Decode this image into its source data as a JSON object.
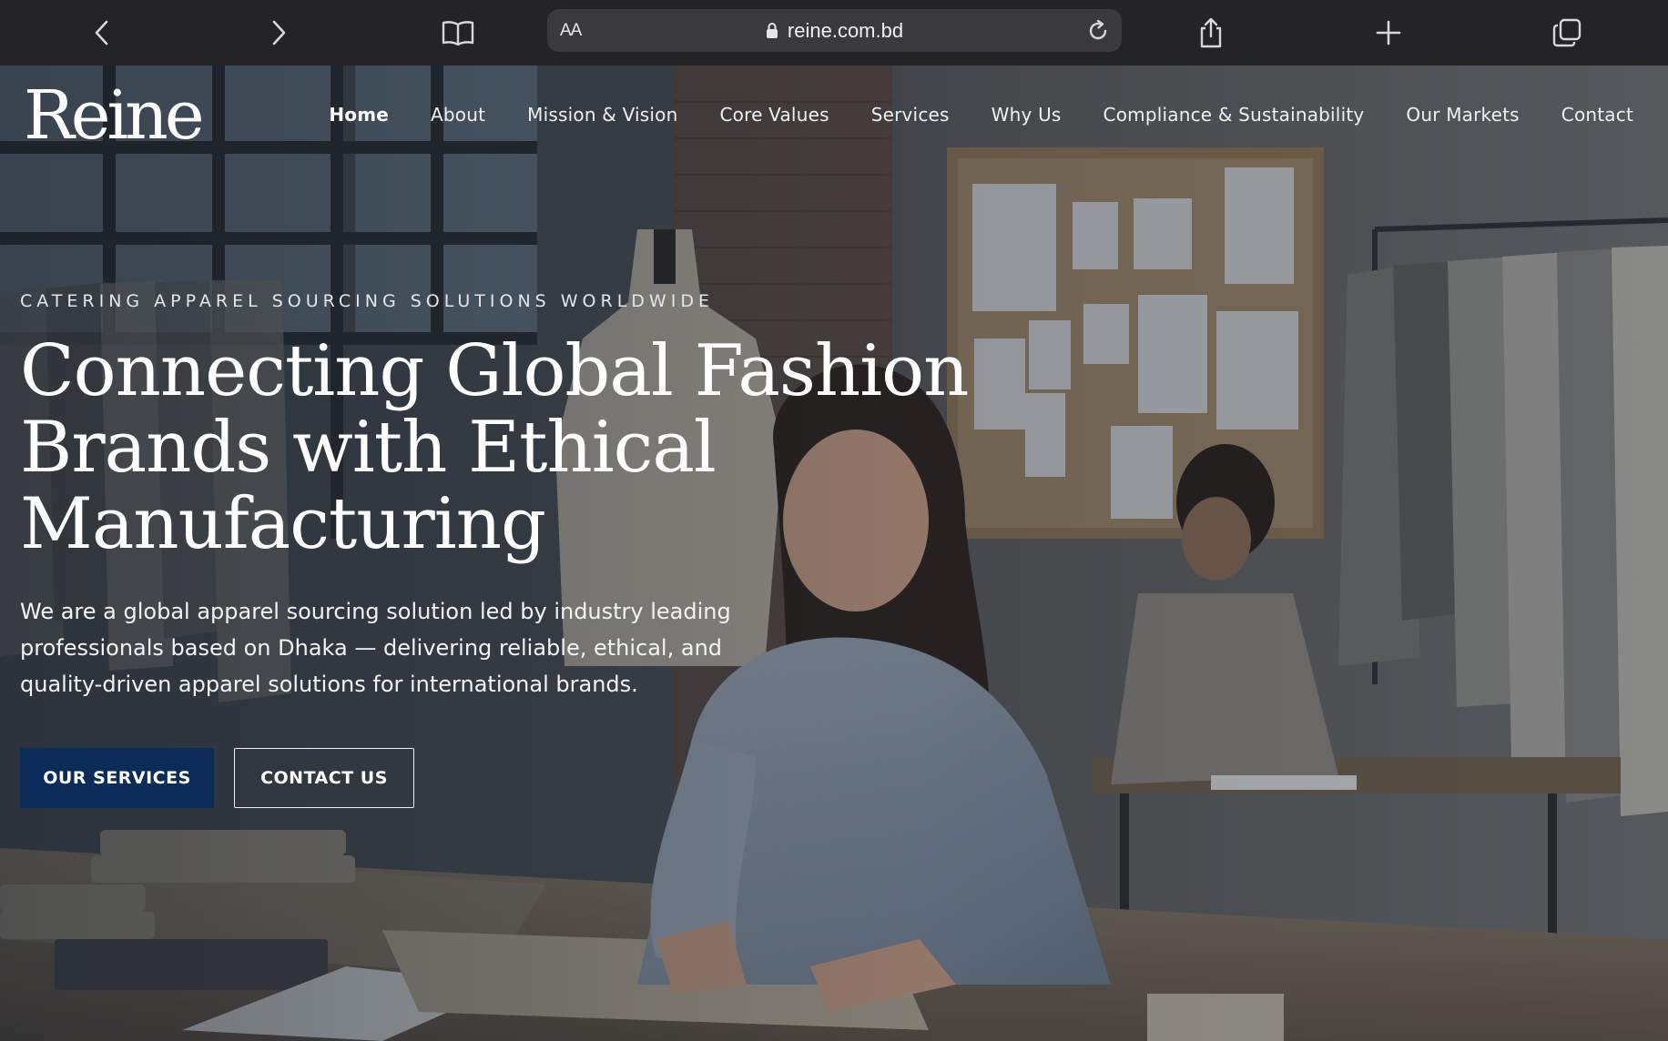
{
  "browser": {
    "text_size_label": "AA",
    "url": "reine.com.bd"
  },
  "site": {
    "logo": "Reine",
    "nav": [
      {
        "label": "Home",
        "active": true
      },
      {
        "label": "About"
      },
      {
        "label": "Mission & Vision"
      },
      {
        "label": "Core Values"
      },
      {
        "label": "Services"
      },
      {
        "label": "Why Us"
      },
      {
        "label": "Compliance & Sustainability"
      },
      {
        "label": "Our Markets"
      },
      {
        "label": "Contact"
      }
    ]
  },
  "hero": {
    "eyebrow": "CATERING APPAREL SOURCING SOLUTIONS WORLDWIDE",
    "headline_lines": [
      "Connecting Global Fashion",
      "Brands with Ethical",
      "Manufacturing"
    ],
    "description": "We are a global apparel sourcing solution led by industry leading professionals based on Dhaka — delivering reliable, ethical, and quality-driven apparel solutions for international brands.",
    "primary_cta": "OUR SERVICES",
    "secondary_cta": "CONTACT US"
  },
  "colors": {
    "primary_button": "#0b2c58",
    "browser_bar": "#242426",
    "url_field": "#3a3a3c"
  }
}
